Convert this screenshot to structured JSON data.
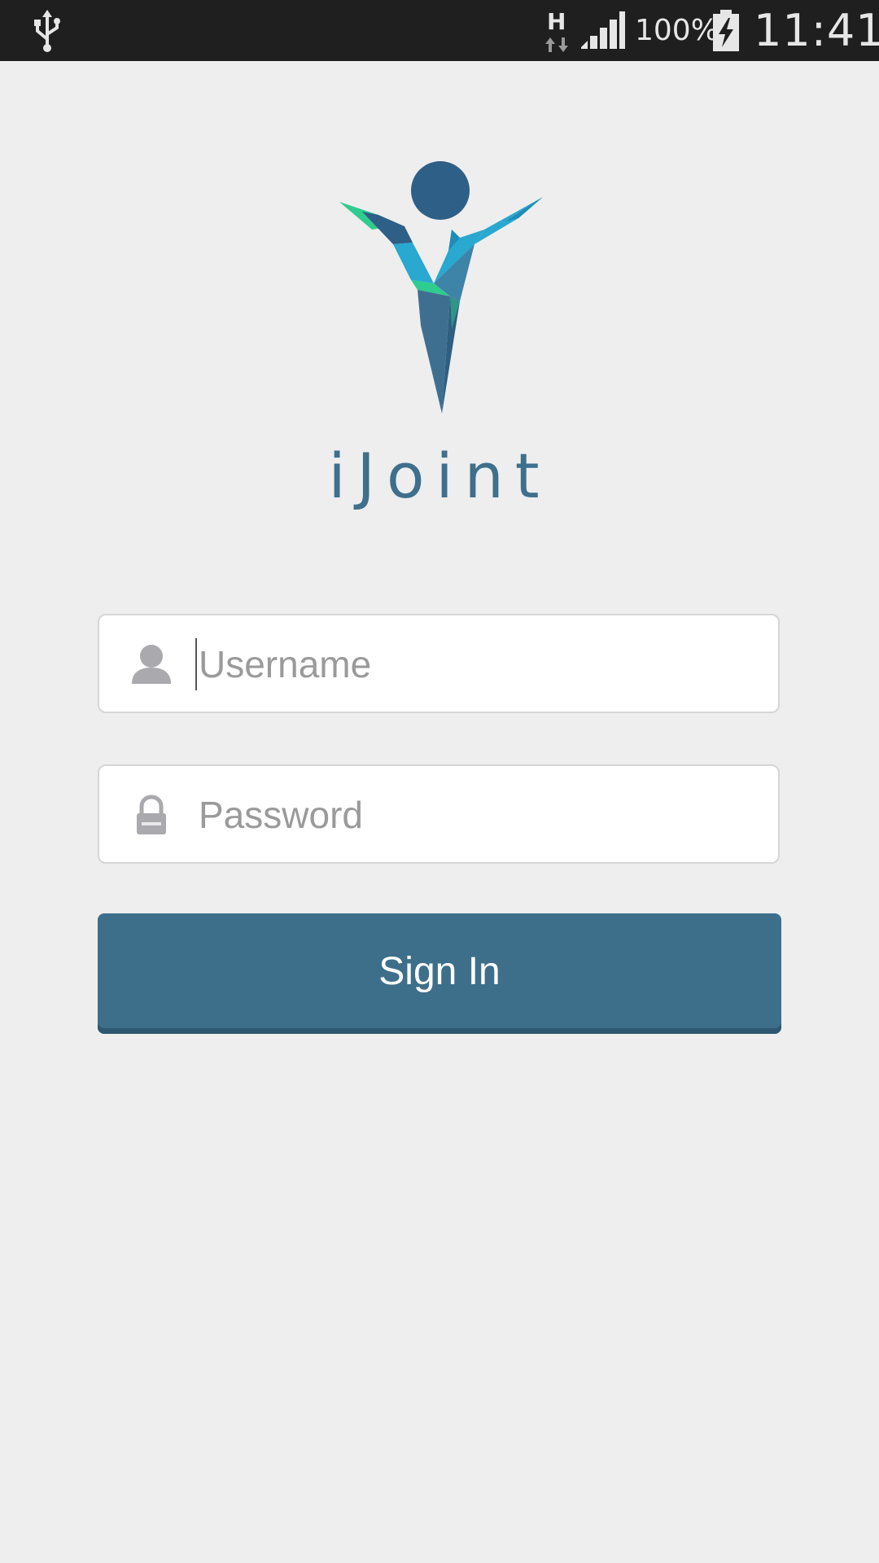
{
  "status_bar": {
    "network_type": "H",
    "battery_percent": "100%",
    "clock": "11:41",
    "icons": [
      "usb-icon",
      "network-h-icon",
      "signal-icon",
      "battery-charging-icon"
    ]
  },
  "brand": {
    "name": "iJoint",
    "logo_icon": "ijoint-figure-logo",
    "colors": {
      "primary": "#3e6f8a",
      "dark_blue": "#2e5f86",
      "cyan": "#29a8d0",
      "green": "#2ecc8e"
    }
  },
  "login_form": {
    "username": {
      "placeholder": "Username",
      "value": "",
      "icon": "user-icon"
    },
    "password": {
      "placeholder": "Password",
      "value": "",
      "icon": "lock-icon"
    },
    "submit_label": "Sign In"
  }
}
